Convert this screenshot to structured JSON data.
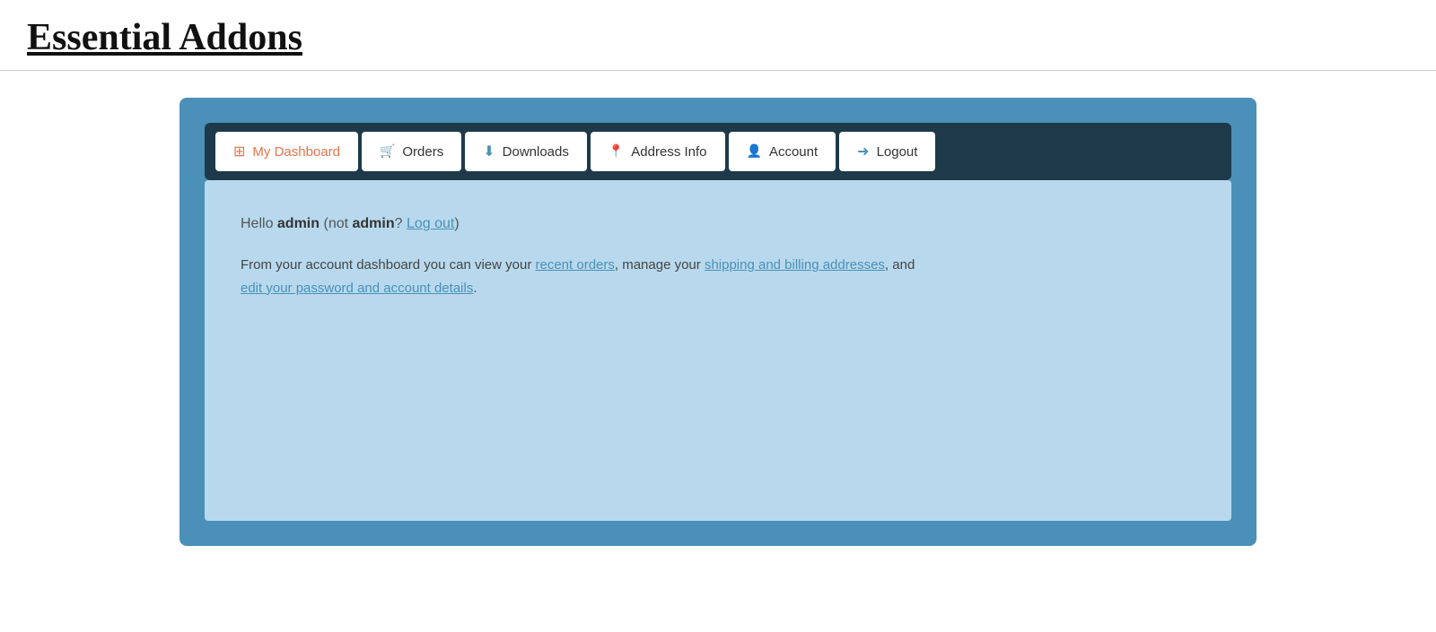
{
  "header": {
    "title": "Essential Addons"
  },
  "nav": {
    "tabs": [
      {
        "id": "dashboard",
        "label": "My Dashboard",
        "icon": "dashboard",
        "active": true
      },
      {
        "id": "orders",
        "label": "Orders",
        "icon": "orders",
        "active": false
      },
      {
        "id": "downloads",
        "label": "Downloads",
        "icon": "downloads",
        "active": false
      },
      {
        "id": "address",
        "label": "Address Info",
        "icon": "address",
        "active": false
      },
      {
        "id": "account",
        "label": "Account",
        "icon": "account",
        "active": false
      },
      {
        "id": "logout",
        "label": "Logout",
        "icon": "logout",
        "active": false
      }
    ]
  },
  "content": {
    "hello_prefix": "Hello ",
    "hello_user": "admin",
    "hello_not": " (not ",
    "hello_not_user": "admin",
    "hello_question": "? ",
    "logout_link": "Log out",
    "hello_close": ")",
    "description_prefix": "From your account dashboard you can view your ",
    "recent_orders_link": "recent orders",
    "description_mid": ", manage your ",
    "shipping_link": "shipping and billing addresses",
    "description_mid2": ", and ",
    "edit_link": "edit your password and account details",
    "description_end": "."
  },
  "colors": {
    "widget_bg": "#4a90b8",
    "nav_bg": "#1e3a4a",
    "content_bg": "#b8d9ed",
    "active_label": "#e8734a",
    "icon_color": "#4a90b8",
    "link_color": "#4a90b8"
  }
}
